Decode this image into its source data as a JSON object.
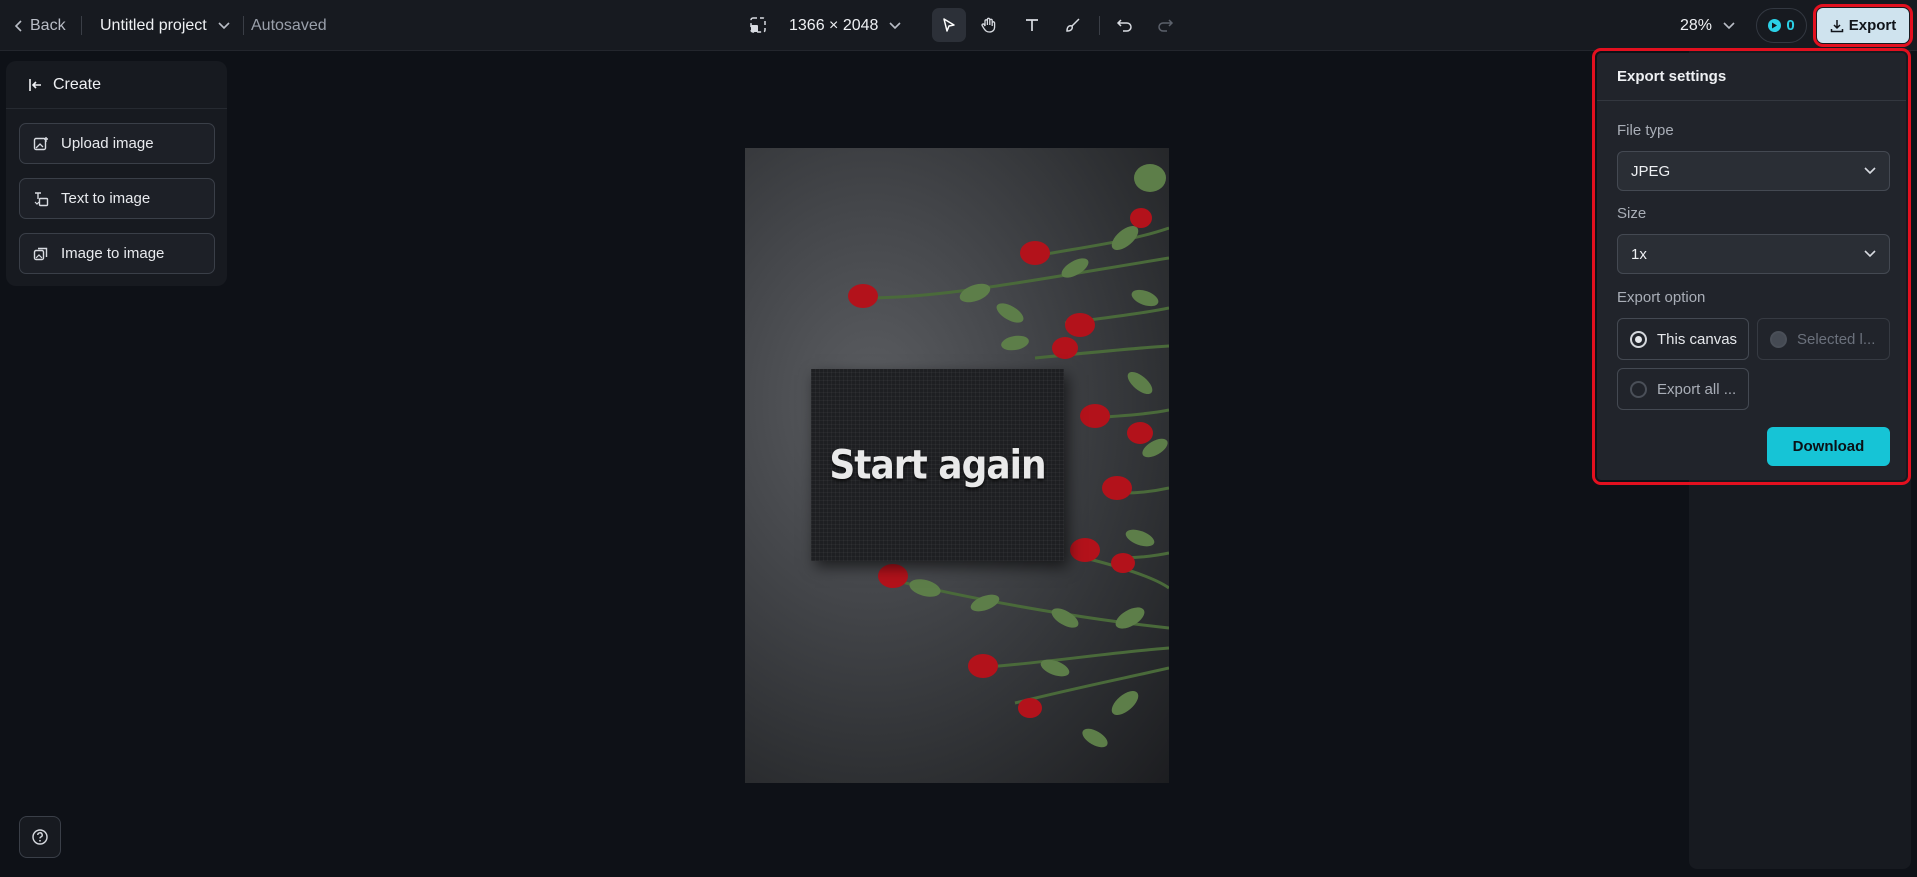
{
  "topbar": {
    "back_label": "Back",
    "project_name": "Untitled project",
    "save_status": "Autosaved",
    "canvas_size": "1366 × 2048",
    "zoom": "28%",
    "credits": "0",
    "export_label": "Export",
    "tools": [
      "select-tool",
      "hand-tool",
      "text-tool",
      "brush-tool",
      "undo",
      "redo"
    ]
  },
  "left_panel": {
    "title": "Create",
    "buttons": [
      {
        "label": "Upload image",
        "icon": "upload-image-icon"
      },
      {
        "label": "Text to image",
        "icon": "text-to-image-icon"
      },
      {
        "label": "Image to image",
        "icon": "image-to-image-icon"
      }
    ]
  },
  "canvas": {
    "text": "Start again"
  },
  "export_popup": {
    "title": "Export settings",
    "file_type_label": "File type",
    "file_type_value": "JPEG",
    "size_label": "Size",
    "size_value": "1x",
    "export_option_label": "Export option",
    "options": [
      {
        "label": "This canvas",
        "selected": true,
        "disabled": false
      },
      {
        "label": "Selected l...",
        "selected": false,
        "disabled": true
      },
      {
        "label": "Export all ...",
        "selected": false,
        "disabled": false
      }
    ],
    "download_label": "Download"
  },
  "colors": {
    "accent": "#16c4d6",
    "highlight": "#e3101f",
    "background": "#0e1117"
  }
}
